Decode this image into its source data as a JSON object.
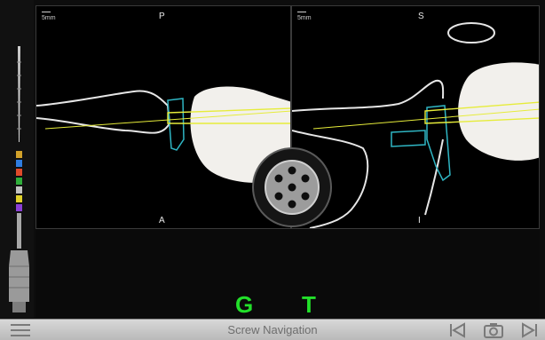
{
  "viewports": {
    "left": {
      "scale": "5mm",
      "top_orientation": "P",
      "bottom_orientation": "A"
    },
    "right": {
      "scale": "5mm",
      "top_orientation": "S",
      "bottom_orientation": "I"
    }
  },
  "guidance": {
    "g_label": "G",
    "t_label": "T"
  },
  "toolbar": {
    "title": "Screw Navigation"
  },
  "colors": {
    "trajectory": "#e6ec3a",
    "implant_outline": "#2fb6c4",
    "guidance_indicator": "#22e02a",
    "bone": "#f2f0ec"
  },
  "icons": {
    "menu": "hamburger-icon",
    "previous": "skip-back-icon",
    "capture": "camera-icon",
    "next": "skip-forward-icon",
    "tool": "drill-icon",
    "dial": "screw-head-icon"
  }
}
